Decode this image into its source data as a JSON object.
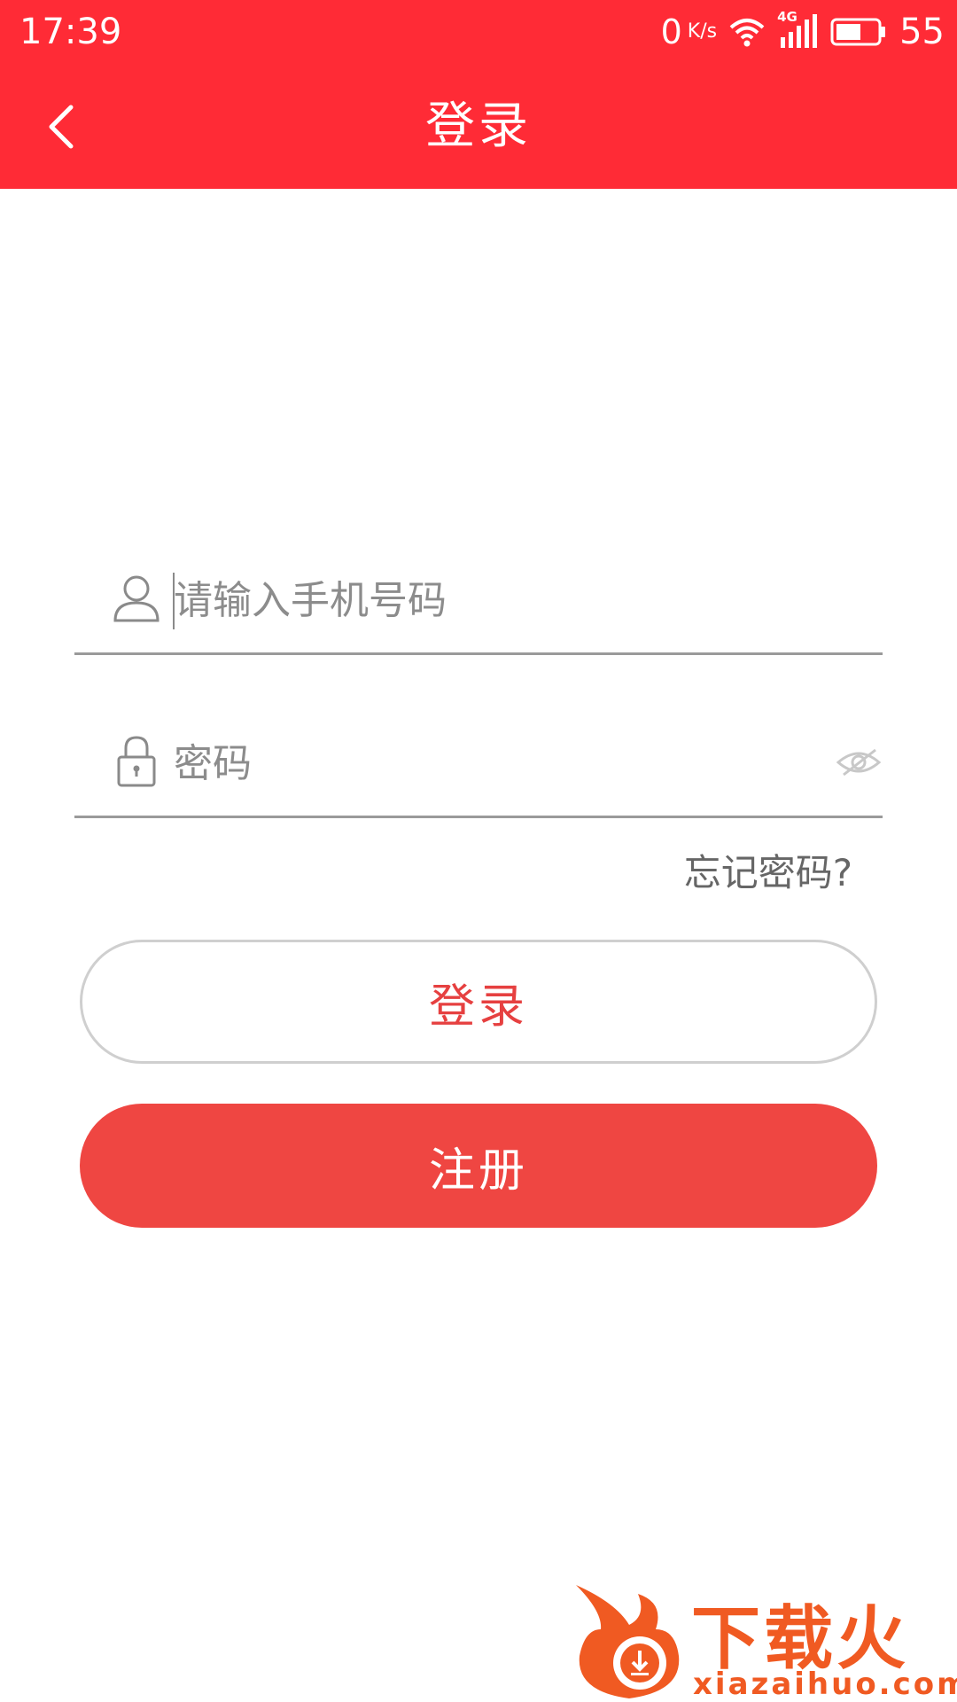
{
  "status_bar": {
    "time": "17:39",
    "net_speed": "0",
    "net_speed_unit": "K/s",
    "network_label": "4G",
    "battery_level": "55"
  },
  "header": {
    "title": "登录",
    "background_color": "#ff2b36"
  },
  "form": {
    "phone": {
      "placeholder": "请输入手机号码",
      "value": ""
    },
    "password": {
      "placeholder": "密码",
      "value": ""
    },
    "forgot_label": "忘记密码?"
  },
  "buttons": {
    "login_label": "登录",
    "register_label": "注册",
    "register_color": "#ef4642"
  },
  "watermark": {
    "brand": "下载火",
    "url": "xiazaihuo.com",
    "color": "#f05a22"
  }
}
